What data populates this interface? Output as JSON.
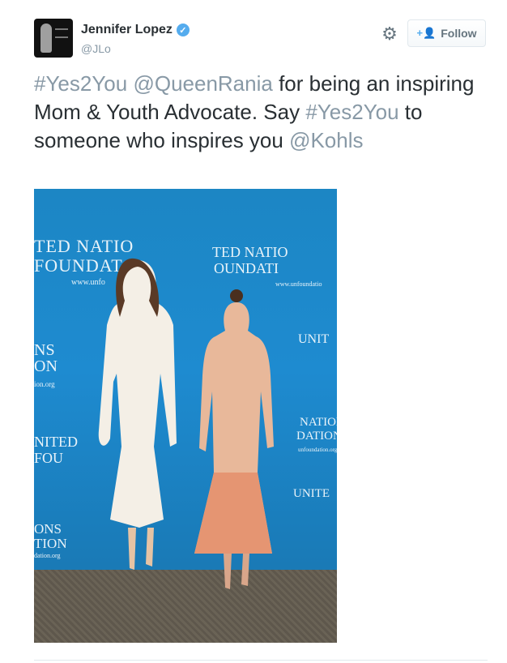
{
  "user": {
    "name": "Jennifer Lopez",
    "handle": "@JLo",
    "verified_glyph": "✓"
  },
  "actions": {
    "gear_icon": "⚙",
    "follow_icon": "+👤",
    "follow_label": "Follow"
  },
  "tweet": {
    "segments": [
      {
        "text": "#Yes2You",
        "kind": "hashtag"
      },
      {
        "text": " ",
        "kind": "text"
      },
      {
        "text": "@QueenRania",
        "kind": "mention"
      },
      {
        "text": " for being an inspiring Mom & Youth Advocate. Say ",
        "kind": "text"
      },
      {
        "text": "#Yes2You",
        "kind": "hashtag"
      },
      {
        "text": " to someone who inspires you ",
        "kind": "text"
      },
      {
        "text": "@Kohls",
        "kind": "mention"
      }
    ]
  },
  "photo": {
    "backdrop_text": [
      "TED NATIO",
      "FOUNDAT",
      "www.unfo",
      "TED NATIO",
      "OUNDATI",
      "www.unfoundatio",
      "NS",
      "ON",
      "ion.org",
      "NITED",
      "FOU",
      "NATIONS",
      "DATION",
      "unfoundation.org",
      "ONS",
      "TION",
      "dation.org",
      "UNIT",
      "UNITE"
    ]
  },
  "colors": {
    "link_gray": "#8899a6",
    "text": "#292f33",
    "accent": "#55acee"
  }
}
